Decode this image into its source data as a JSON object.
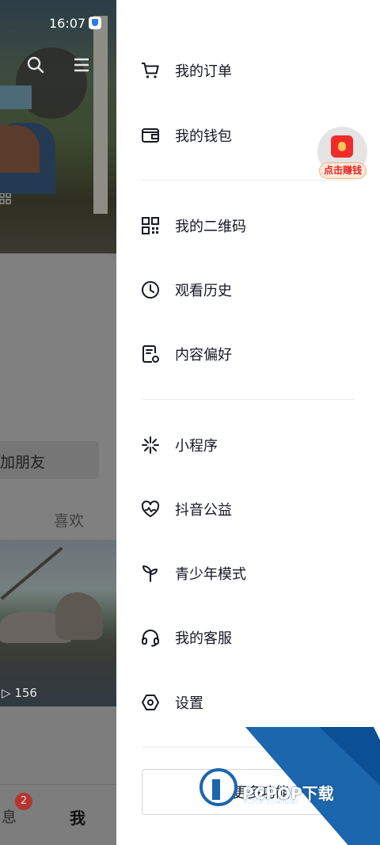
{
  "status_bar": {
    "time": "16:07"
  },
  "background_page": {
    "add_friend_label": "加朋友",
    "likes_tab_label": "喜欢",
    "video_play_count": "156",
    "tabbar": {
      "messages_label": "息",
      "messages_badge": "2",
      "me_label": "我"
    }
  },
  "drawer": {
    "group1": [
      {
        "label": "我的订单",
        "icon": "cart-icon"
      },
      {
        "label": "我的钱包",
        "icon": "wallet-icon"
      }
    ],
    "group2": [
      {
        "label": "我的二维码",
        "icon": "qr-code-icon"
      },
      {
        "label": "观看历史",
        "icon": "clock-icon"
      },
      {
        "label": "内容偏好",
        "icon": "preference-icon"
      }
    ],
    "group3": [
      {
        "label": "小程序",
        "icon": "mini-program-icon"
      },
      {
        "label": "抖音公益",
        "icon": "charity-heart-icon"
      },
      {
        "label": "青少年模式",
        "icon": "sprout-icon"
      },
      {
        "label": "我的客服",
        "icon": "headset-icon"
      },
      {
        "label": "设置",
        "icon": "settings-hexagon-icon"
      }
    ],
    "more_button_label": "更多功能"
  },
  "red_packet": {
    "label": "点击赚钱"
  },
  "watermark": {
    "text": "PCPOP下载",
    "subtext": "PCPOP Download"
  },
  "colors": {
    "text": "#161823",
    "accent_red": "#ef2b2b",
    "watermark_blue": "#0b4f94"
  }
}
